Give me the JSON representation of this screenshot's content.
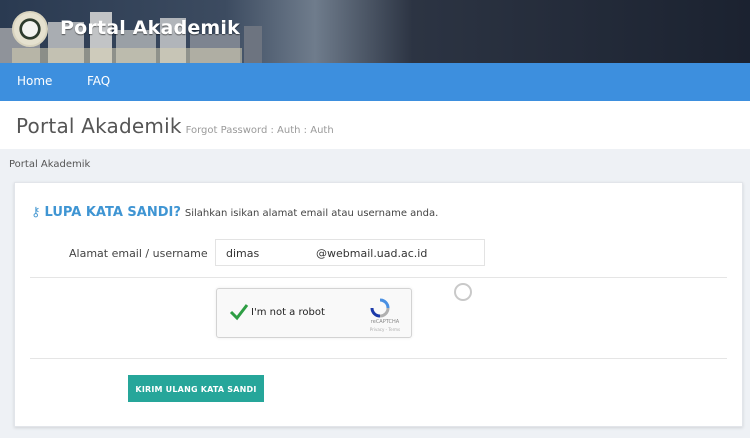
{
  "header": {
    "app_title": "Portal Akademik",
    "logo_icon": "university-seal-icon"
  },
  "nav": {
    "items": [
      {
        "label": "Home"
      },
      {
        "label": "FAQ"
      }
    ]
  },
  "page": {
    "title": "Portal Akademik",
    "subtitle": "Forgot Password : Auth : Auth",
    "breadcrumb": "Portal Akademik"
  },
  "form": {
    "heading_icon": "key-icon",
    "heading_title": "LUPA KATA SANDI?",
    "heading_desc": "Silahkan isikan alamat email atau username anda.",
    "email_label": "Alamat email / username",
    "email_value_user": "dimas",
    "email_value_domain": "@webmail.uad.ac.id",
    "captcha": {
      "label": "I'm not a robot",
      "brand": "reCAPTCHA",
      "terms": "Privacy - Terms",
      "checked": true
    },
    "submit_label": "KIRIM ULANG KATA SANDI"
  },
  "colors": {
    "nav_bg": "#3d8fde",
    "heading_accent": "#3f95d3",
    "button_bg": "#26a69a",
    "check_green": "#2e9e44"
  }
}
